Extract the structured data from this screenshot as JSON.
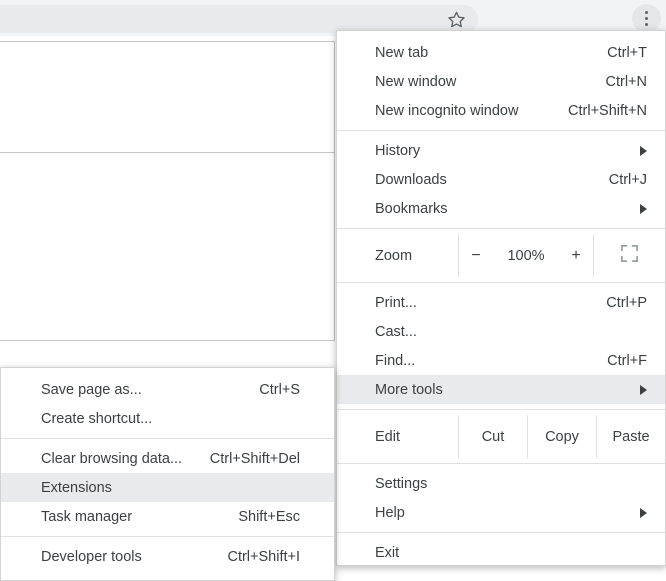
{
  "browser": {
    "omnibox": {
      "value": ""
    },
    "bookmark_icon": "star-outline-icon",
    "menu_button_icon": "three-dot-menu-icon"
  },
  "main_menu": {
    "sections": [
      {
        "items": [
          {
            "label": "New tab",
            "accel": "Ctrl+T",
            "submenu": false
          },
          {
            "label": "New window",
            "accel": "Ctrl+N",
            "submenu": false
          },
          {
            "label": "New incognito window",
            "accel": "Ctrl+Shift+N",
            "submenu": false
          }
        ]
      },
      {
        "items": [
          {
            "label": "History",
            "accel": "",
            "submenu": true
          },
          {
            "label": "Downloads",
            "accel": "Ctrl+J",
            "submenu": false
          },
          {
            "label": "Bookmarks",
            "accel": "",
            "submenu": true
          }
        ]
      },
      {
        "zoom_row": {
          "label": "Zoom",
          "minus": "−",
          "value": "100%",
          "plus": "+",
          "fullscreen_icon": "fullscreen-icon"
        }
      },
      {
        "items": [
          {
            "label": "Print...",
            "accel": "Ctrl+P",
            "submenu": false
          },
          {
            "label": "Cast...",
            "accel": "",
            "submenu": false
          },
          {
            "label": "Find...",
            "accel": "Ctrl+F",
            "submenu": false
          },
          {
            "label": "More tools",
            "accel": "",
            "submenu": true,
            "highlighted": true
          }
        ]
      },
      {
        "edit_row": {
          "label": "Edit",
          "cut": "Cut",
          "copy": "Copy",
          "paste": "Paste"
        }
      },
      {
        "items": [
          {
            "label": "Settings",
            "accel": "",
            "submenu": false
          },
          {
            "label": "Help",
            "accel": "",
            "submenu": true
          }
        ]
      },
      {
        "items": [
          {
            "label": "Exit",
            "accel": "",
            "submenu": false
          }
        ]
      }
    ]
  },
  "more_tools_submenu": {
    "items": [
      {
        "label": "Save page as...",
        "accel": "Ctrl+S",
        "highlighted": false
      },
      {
        "label": "Create shortcut...",
        "accel": "",
        "highlighted": false
      },
      {
        "label": "Clear browsing data...",
        "accel": "Ctrl+Shift+Del",
        "highlighted": false
      },
      {
        "label": "Extensions",
        "accel": "",
        "highlighted": true
      },
      {
        "label": "Task manager",
        "accel": "Shift+Esc",
        "highlighted": false
      },
      {
        "label": "Developer tools",
        "accel": "Ctrl+Shift+I",
        "highlighted": false
      }
    ]
  },
  "colors": {
    "toolbar_bg": "#f1f3f4",
    "menu_bg": "#ffffff",
    "highlight_bg": "#e8eaed",
    "text": "#3c4043",
    "separator": "#e0e0e0"
  }
}
